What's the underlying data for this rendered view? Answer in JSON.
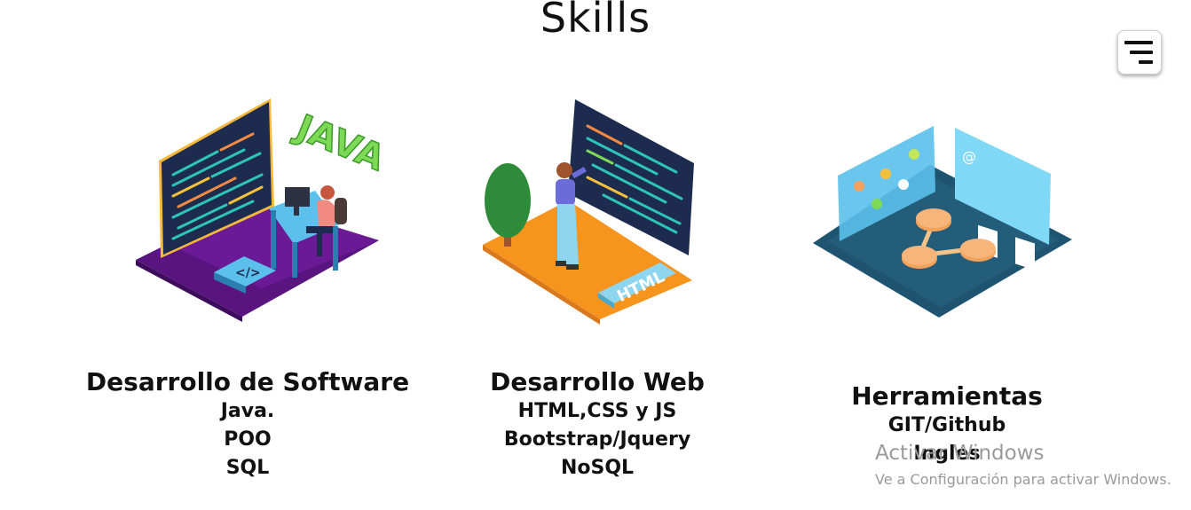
{
  "page": {
    "title": "Skills"
  },
  "menu": {
    "icon": "hamburger-menu-icon"
  },
  "cards": [
    {
      "title": "Desarrollo de Software",
      "items": [
        "Java.",
        "POO",
        "SQL"
      ],
      "illustration_text": "JAVA",
      "accent": "#6a1b9a"
    },
    {
      "title": "Desarrollo Web",
      "items": [
        "HTML,CSS y JS",
        "Bootstrap/Jquery",
        "NoSQL"
      ],
      "illustration_text": "HTML",
      "accent": "#f7941d"
    },
    {
      "title": "Herramientas",
      "items": [
        "GIT/Github",
        "Ingles"
      ],
      "accent": "#1f5470"
    }
  ],
  "watermark": {
    "title": "Activar Windows",
    "subtitle": "Ve a Configuración para activar Windows."
  }
}
